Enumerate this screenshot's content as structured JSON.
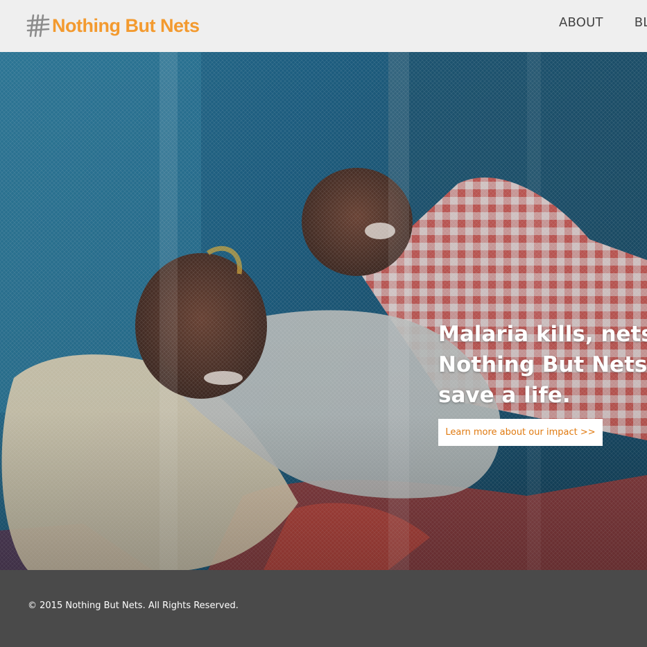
{
  "header": {
    "logo_text": "Nothing But Nets",
    "logo_icon": "net-grid-icon",
    "nav": [
      "ABOUT",
      "BL"
    ]
  },
  "hero": {
    "headline_lines": [
      "Malaria kills, nets sa",
      "Nothing But Nets to",
      "save a life."
    ],
    "cta_label": "Learn more about our impact >>"
  },
  "footer": {
    "copyright": "© 2015 Nothing But Nets. All Rights Reserved."
  },
  "colors": {
    "brand_orange": "#f39a2f",
    "cta_text": "#e07a10",
    "header_bg": "#efefef",
    "footer_bg": "#4a4a4a"
  }
}
